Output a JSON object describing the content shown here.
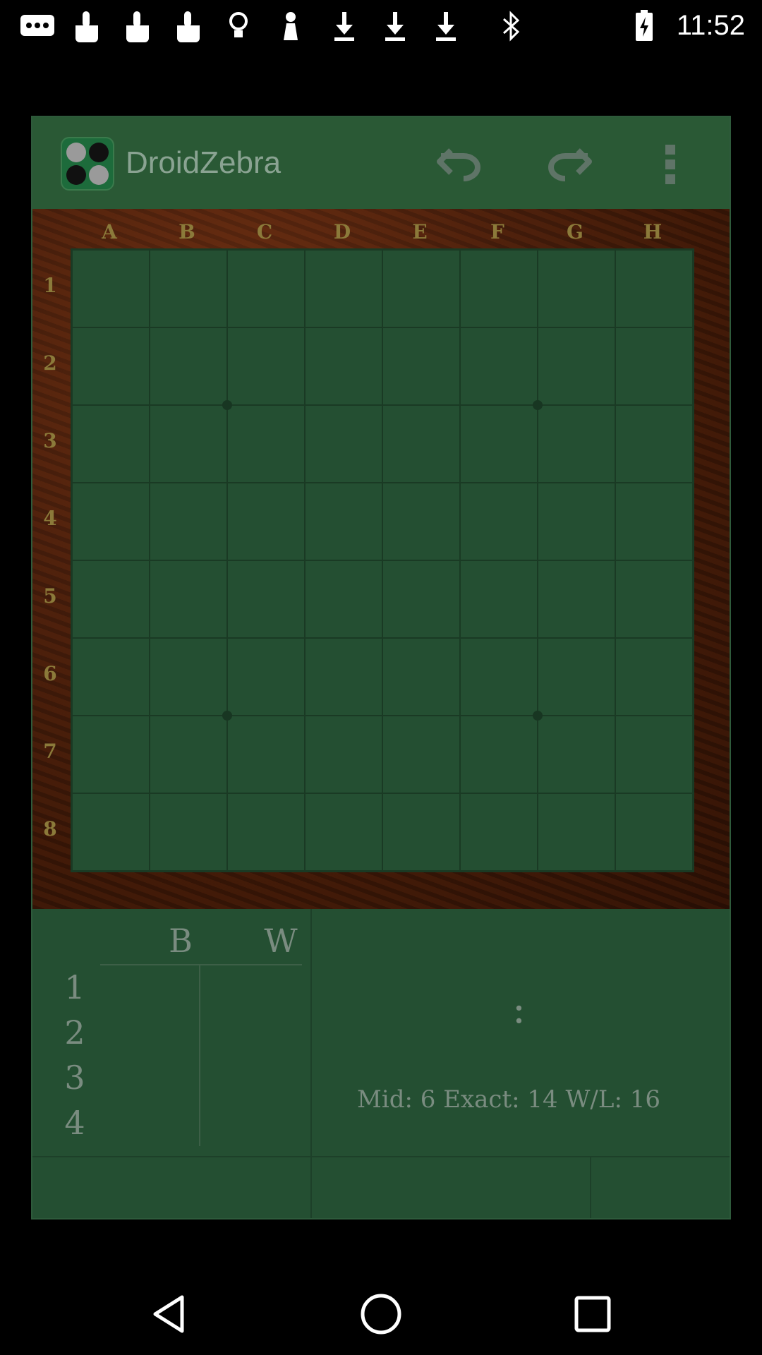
{
  "status_bar": {
    "time": "11:52",
    "icons": [
      "messaging-icon",
      "touch-icon",
      "touch-icon",
      "touch-icon",
      "lightbulb-icon",
      "pawn-icon",
      "download-icon",
      "download-icon",
      "download-icon",
      "bluetooth-icon",
      "battery-charging-icon"
    ]
  },
  "app": {
    "title": "DroidZebra",
    "actions": [
      "undo-icon",
      "redo-icon",
      "overflow-menu-icon"
    ]
  },
  "board": {
    "columns": [
      "A",
      "B",
      "C",
      "D",
      "E",
      "F",
      "G",
      "H"
    ],
    "rows": [
      "1",
      "2",
      "3",
      "4",
      "5",
      "6",
      "7",
      "8"
    ]
  },
  "move_list": {
    "black_header": "B",
    "white_header": "W",
    "move_numbers": [
      "1",
      "2",
      "3",
      "4"
    ]
  },
  "status_panel": {
    "score_separator": ":",
    "settings_text": "Mid: 6 Exact: 14 W/L: 16"
  },
  "colors": {
    "background": "#000000",
    "board_green": "#244f32",
    "frame_wood": "#4a1f0c",
    "label_gold": "#8b7a3a"
  }
}
